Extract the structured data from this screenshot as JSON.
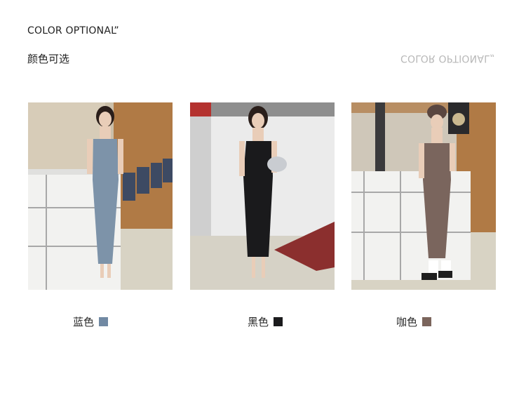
{
  "header": {
    "title_en": "COLOR OPTIONAL”",
    "title_cn": "颜色可选",
    "mirrored_text": "COLOR OPTIONAL„"
  },
  "variants": [
    {
      "label": "蓝色",
      "swatch_color": "#7189a3",
      "dress_color": "#7d93a9"
    },
    {
      "label": "黑色",
      "swatch_color": "#1b1b1d",
      "dress_color": "#1a1a1c"
    },
    {
      "label": "咖色",
      "swatch_color": "#7b655c",
      "dress_color": "#7a655d"
    }
  ]
}
